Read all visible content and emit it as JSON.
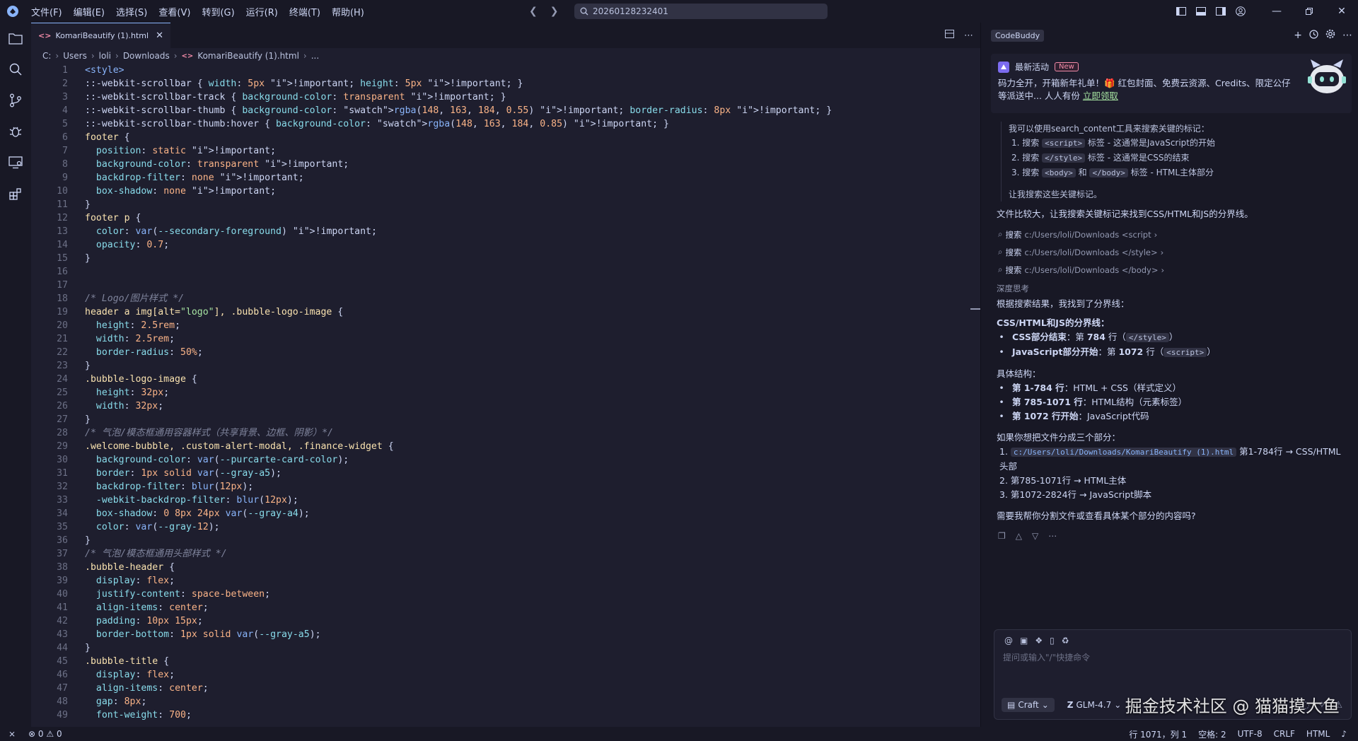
{
  "menu": [
    "文件(F)",
    "编辑(E)",
    "选择(S)",
    "查看(V)",
    "转到(G)",
    "运行(R)",
    "终端(T)",
    "帮助(H)"
  ],
  "command_center": {
    "text": "20260128232401"
  },
  "editor": {
    "tab_label": "KomariBeautify (1).html",
    "breadcrumb": [
      "C:",
      "Users",
      "loli",
      "Downloads",
      "KomariBeautify (1).html",
      "..."
    ]
  },
  "code_lines": [
    "<style>",
    "::-webkit-scrollbar { width: 5px !important; height: 5px !important; }",
    "::-webkit-scrollbar-track { background-color: transparent !important; }",
    "::-webkit-scrollbar-thumb { background-color: ■rgba(148, 163, 184, 0.55) !important; border-radius: 8px !important; }",
    "::-webkit-scrollbar-thumb:hover { background-color: ■rgba(148, 163, 184, 0.85) !important; }",
    "footer {",
    "  position: static !important;",
    "  background-color: transparent !important;",
    "  backdrop-filter: none !important;",
    "  box-shadow: none !important;",
    "}",
    "footer p {",
    "  color: var(--secondary-foreground) !important;",
    "  opacity: 0.7;",
    "}",
    "",
    "",
    "/* Logo/图片样式 */",
    "header a img[alt=\"logo\"], .bubble-logo-image {",
    "  height: 2.5rem;",
    "  width: 2.5rem;",
    "  border-radius: 50%;",
    "}",
    ".bubble-logo-image {",
    "  height: 32px;",
    "  width: 32px;",
    "}",
    "/* 气泡/模态框通用容器样式（共享背景、边框、阴影）*/",
    ".welcome-bubble, .custom-alert-modal, .finance-widget {",
    "  background-color: var(--purcarte-card-color);",
    "  border: 1px solid var(--gray-a5);",
    "  backdrop-filter: blur(12px);",
    "  -webkit-backdrop-filter: blur(12px);",
    "  box-shadow: 0 8px 24px var(--gray-a4);",
    "  color: var(--gray-12);",
    "}",
    "/* 气泡/模态框通用头部样式 */",
    ".bubble-header {",
    "  display: flex;",
    "  justify-content: space-between;",
    "  align-items: center;",
    "  padding: 10px 15px;",
    "  border-bottom: 1px solid var(--gray-a5);",
    "}",
    ".bubble-title {",
    "  display: flex;",
    "  align-items: center;",
    "  gap: 8px;",
    "  font-weight: 700;"
  ],
  "panel": {
    "tab": "CodeBuddy",
    "promo": {
      "title": "最新活动",
      "badge": "New",
      "text": "码力全开，开箱新年礼单！🎁 红包封面、免费云资源、Credits、限定公仔等派送中... 人人有份",
      "link": "立即领取"
    },
    "think_intro": "我可以使用search_content工具来搜索关键的标记：",
    "think_steps": [
      {
        "pre": "1. 搜索 ",
        "code": "<script>",
        "post": " 标签 - 这通常是JavaScript的开始"
      },
      {
        "pre": "2. 搜索 ",
        "code": "</style>",
        "post": " 标签 - 这通常是CSS的结束"
      },
      {
        "pre": "3. 搜索 ",
        "code": "<body>",
        "mid": " 和 ",
        "code2": "</body>",
        "post": " 标签 - HTML主体部分"
      }
    ],
    "think_outro": "让我搜索这些关键标记。",
    "msg1": "文件比较大，让我搜索关键标记来找到CSS/HTML和JS的分界线。",
    "searches": [
      {
        "label": "搜索",
        "path": "c:/Users/loli/Downloads <script"
      },
      {
        "label": "搜索",
        "path": "c:/Users/loli/Downloads </style>"
      },
      {
        "label": "搜索",
        "path": "c:/Users/loli/Downloads </body>"
      }
    ],
    "deep_think": "深度思考",
    "result_intro": "根据搜索结果，我找到了分界线：",
    "section1_title": "CSS/HTML和JS的分界线：",
    "section1": [
      {
        "bold": "CSS部分结束",
        "text": "：第 ",
        "num": "784",
        "text2": " 行（",
        "code": "</style>",
        "text3": "）"
      },
      {
        "bold": "JavaScript部分开始",
        "text": "：第 ",
        "num": "1072",
        "text2": " 行（",
        "code": "<script>",
        "text3": "）"
      }
    ],
    "section2_title": "具体结构：",
    "section2": [
      {
        "bold": "第 1-784 行",
        "text": "：HTML + CSS（样式定义）"
      },
      {
        "bold": "第 785-1071 行",
        "text": "：HTML结构（元素标签）"
      },
      {
        "bold": "第 1072 行开始",
        "text": "：JavaScript代码"
      }
    ],
    "section3_title": "如果你想把文件分成三个部分：",
    "section3_item1_num": "1.",
    "section3_item1_path": "c:/Users/loli/Downloads/KomariBeautify (1).html",
    "section3_item1_text": " 第1-784行 → CSS/HTML头部",
    "section3_item2": "2. 第785-1071行 → HTML主体",
    "section3_item3": "3. 第1072-2824行 → JavaScript脚本",
    "question": "需要我帮你分割文件或查看具体某个部分的内容吗?",
    "input_placeholder": "提问或输入\"/\"快捷命令",
    "mode": "Craft",
    "model": "GLM-4.7"
  },
  "watermark": "掘金技术社区 @ 猫猫摸大鱼",
  "status": {
    "errors": "0",
    "warnings": "0",
    "position": "行 1071，列 1",
    "spaces": "空格: 2",
    "encoding": "UTF-8",
    "eol": "CRLF",
    "language": "HTML"
  },
  "colors": {
    "accent": "#89b4fa",
    "background": "#1e1e2e",
    "sidebar": "#181825"
  }
}
